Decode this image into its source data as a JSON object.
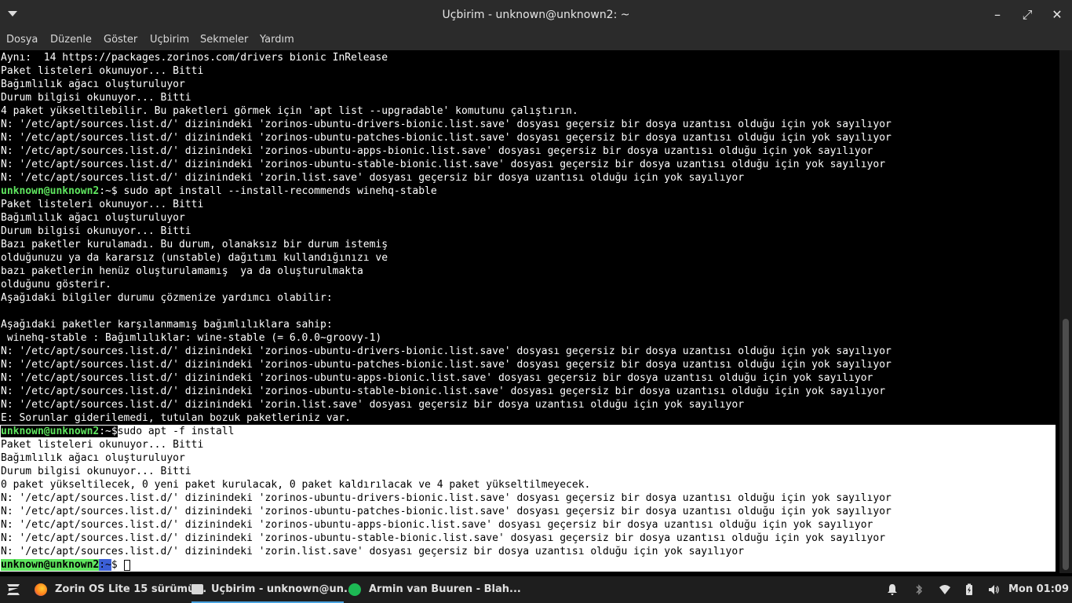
{
  "window": {
    "title": "Uçbirim - unknown@unknown2: ~",
    "minimize": "–",
    "maximize": "⤢",
    "close": "✕"
  },
  "menu": [
    "Dosya",
    "Düzenle",
    "Göster",
    "Uçbirim",
    "Sekmeler",
    "Yardım"
  ],
  "terminal": {
    "prompt_user": "unknown@unknown2",
    "prompt_path": ":~",
    "prompt_symbol": "$",
    "lines": [
      "Aynı:  14 https://packages.zorinos.com/drivers bionic InRelease",
      "Paket listeleri okunuyor... Bitti",
      "Bağımlılık ağacı oluşturuluyor",
      "Durum bilgisi okunuyor... Bitti",
      "4 paket yükseltilebilir. Bu paketleri görmek için 'apt list --upgradable' komutunu çalıştırın.",
      "N: '/etc/apt/sources.list.d/' dizinindeki 'zorinos-ubuntu-drivers-bionic.list.save' dosyası geçersiz bir dosya uzantısı olduğu için yok sayılıyor",
      "N: '/etc/apt/sources.list.d/' dizinindeki 'zorinos-ubuntu-patches-bionic.list.save' dosyası geçersiz bir dosya uzantısı olduğu için yok sayılıyor",
      "N: '/etc/apt/sources.list.d/' dizinindeki 'zorinos-ubuntu-apps-bionic.list.save' dosyası geçersiz bir dosya uzantısı olduğu için yok sayılıyor",
      "N: '/etc/apt/sources.list.d/' dizinindeki 'zorinos-ubuntu-stable-bionic.list.save' dosyası geçersiz bir dosya uzantısı olduğu için yok sayılıyor",
      "N: '/etc/apt/sources.list.d/' dizinindeki 'zorin.list.save' dosyası geçersiz bir dosya uzantısı olduğu için yok sayılıyor",
      "",
      "Paket listeleri okunuyor... Bitti",
      "Bağımlılık ağacı oluşturuluyor",
      "Durum bilgisi okunuyor... Bitti",
      "Bazı paketler kurulamadı. Bu durum, olanaksız bir durum istemiş",
      "olduğunuzu ya da kararsız (unstable) dağıtımı kullandığınızı ve",
      "bazı paketlerin henüz oluşturulamamış  ya da oluşturulmakta",
      "olduğunu gösterir.",
      "Aşağıdaki bilgiler durumu çözmenize yardımcı olabilir:",
      "",
      "Aşağıdaki paketler karşılanmamış bağımlılıklara sahip:",
      " winehq-stable : Bağımlılıklar: wine-stable (= 6.0.0~groovy-1)",
      "N: '/etc/apt/sources.list.d/' dizinindeki 'zorinos-ubuntu-drivers-bionic.list.save' dosyası geçersiz bir dosya uzantısı olduğu için yok sayılıyor",
      "N: '/etc/apt/sources.list.d/' dizinindeki 'zorinos-ubuntu-patches-bionic.list.save' dosyası geçersiz bir dosya uzantısı olduğu için yok sayılıyor",
      "N: '/etc/apt/sources.list.d/' dizinindeki 'zorinos-ubuntu-apps-bionic.list.save' dosyası geçersiz bir dosya uzantısı olduğu için yok sayılıyor",
      "N: '/etc/apt/sources.list.d/' dizinindeki 'zorinos-ubuntu-stable-bionic.list.save' dosyası geçersiz bir dosya uzantısı olduğu için yok sayılıyor",
      "N: '/etc/apt/sources.list.d/' dizinindeki 'zorin.list.save' dosyası geçersiz bir dosya uzantısı olduğu için yok sayılıyor",
      "E: Sorunlar giderilemedi, tutulan bozuk paketleriniz var.",
      "",
      "Paket listeleri okunuyor... Bitti",
      "Bağımlılık ağacı oluşturuluyor",
      "Durum bilgisi okunuyor... Bitti",
      "0 paket yükseltilecek, 0 yeni paket kurulacak, 0 paket kaldırılacak ve 4 paket yükseltilmeyecek.",
      "N: '/etc/apt/sources.list.d/' dizinindeki 'zorinos-ubuntu-drivers-bionic.list.save' dosyası geçersiz bir dosya uzantısı olduğu için yok sayılıyor",
      "N: '/etc/apt/sources.list.d/' dizinindeki 'zorinos-ubuntu-patches-bionic.list.save' dosyası geçersiz bir dosya uzantısı olduğu için yok sayılıyor",
      "N: '/etc/apt/sources.list.d/' dizinindeki 'zorinos-ubuntu-apps-bionic.list.save' dosyası geçersiz bir dosya uzantısı olduğu için yok sayılıyor",
      "N: '/etc/apt/sources.list.d/' dizinindeki 'zorinos-ubuntu-stable-bionic.list.save' dosyası geçersiz bir dosya uzantısı olduğu için yok sayılıyor",
      "N: '/etc/apt/sources.list.d/' dizinindeki 'zorin.list.save' dosyası geçersiz bir dosya uzantısı olduğu için yok sayılıyor"
    ],
    "commands": {
      "cmd1": " sudo apt install --install-recommends winehq-stable",
      "cmd2": "sudo apt -f install"
    }
  },
  "taskbar": {
    "tasks": [
      {
        "label": "Zorin OS Lite 15 sürümü...",
        "icon": "firefox-icon"
      },
      {
        "label": "Uçbirim - unknown@un...",
        "icon": "terminal-icon"
      },
      {
        "label": "Armin van Buuren - Blah...",
        "icon": "spotify-icon"
      }
    ],
    "clock": "Mon 01:09"
  },
  "colors": {
    "prompt_green": "#5fe65f",
    "prompt_path": "#3b8eea",
    "spotify": "#1db954",
    "firefox": "#ff7a1a",
    "accent": "#4aa3df"
  }
}
